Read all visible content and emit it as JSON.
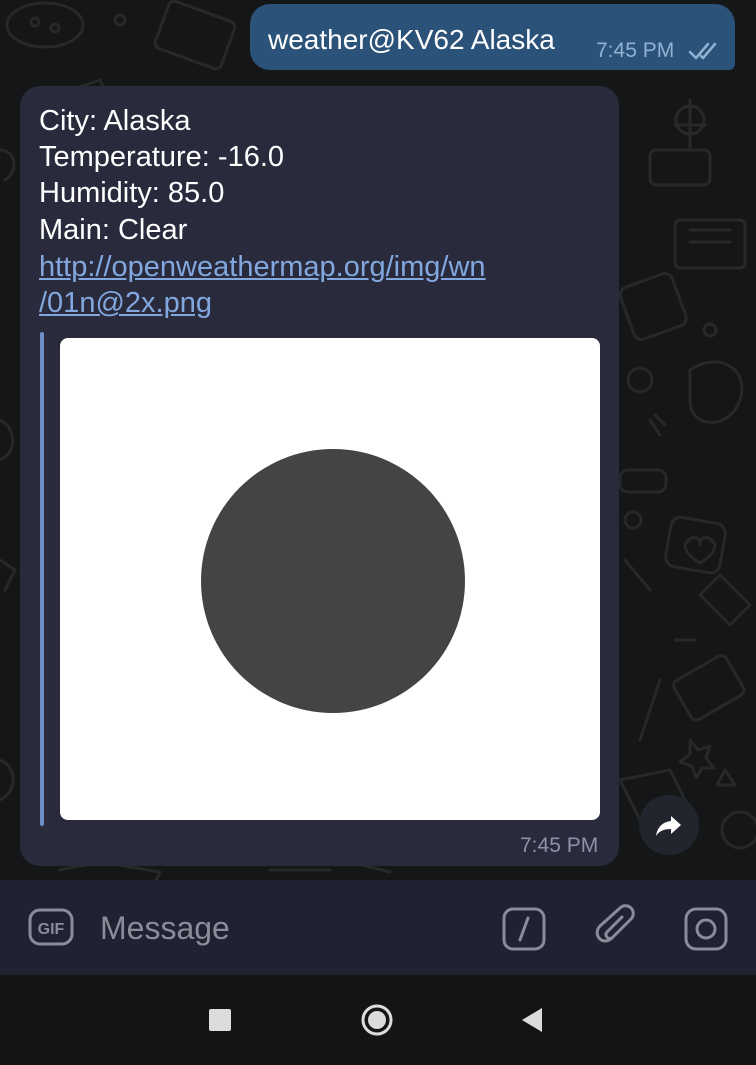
{
  "outgoing_message": {
    "text": "weather@KV62 Alaska",
    "time": "7:45 PM",
    "status_icon": "double-check-icon"
  },
  "incoming_message": {
    "lines": [
      "City: Alaska",
      "Temperature: -16.0",
      "Humidity: 85.0",
      "Main: Clear"
    ],
    "link_lines": [
      "http://openweathermap.org/img/wn",
      "/01n@2x.png"
    ],
    "time": "7:45 PM",
    "preview_icon": "weather-clear-night-icon"
  },
  "input_bar": {
    "gif_label": "GIF",
    "message_placeholder": "Message",
    "commands_icon": "slash-commands-icon",
    "attach_icon": "paperclip-icon",
    "camera_icon": "camera-icon"
  },
  "nav_bar": {
    "icons": [
      "recents-square-icon",
      "home-circle-icon",
      "back-triangle-icon"
    ]
  },
  "colors": {
    "chat_background": "#151617",
    "outgoing_bubble": "#2b5278",
    "incoming_bubble": "#292b3d",
    "link": "#82a7de",
    "input_bar": "#1f2230"
  }
}
